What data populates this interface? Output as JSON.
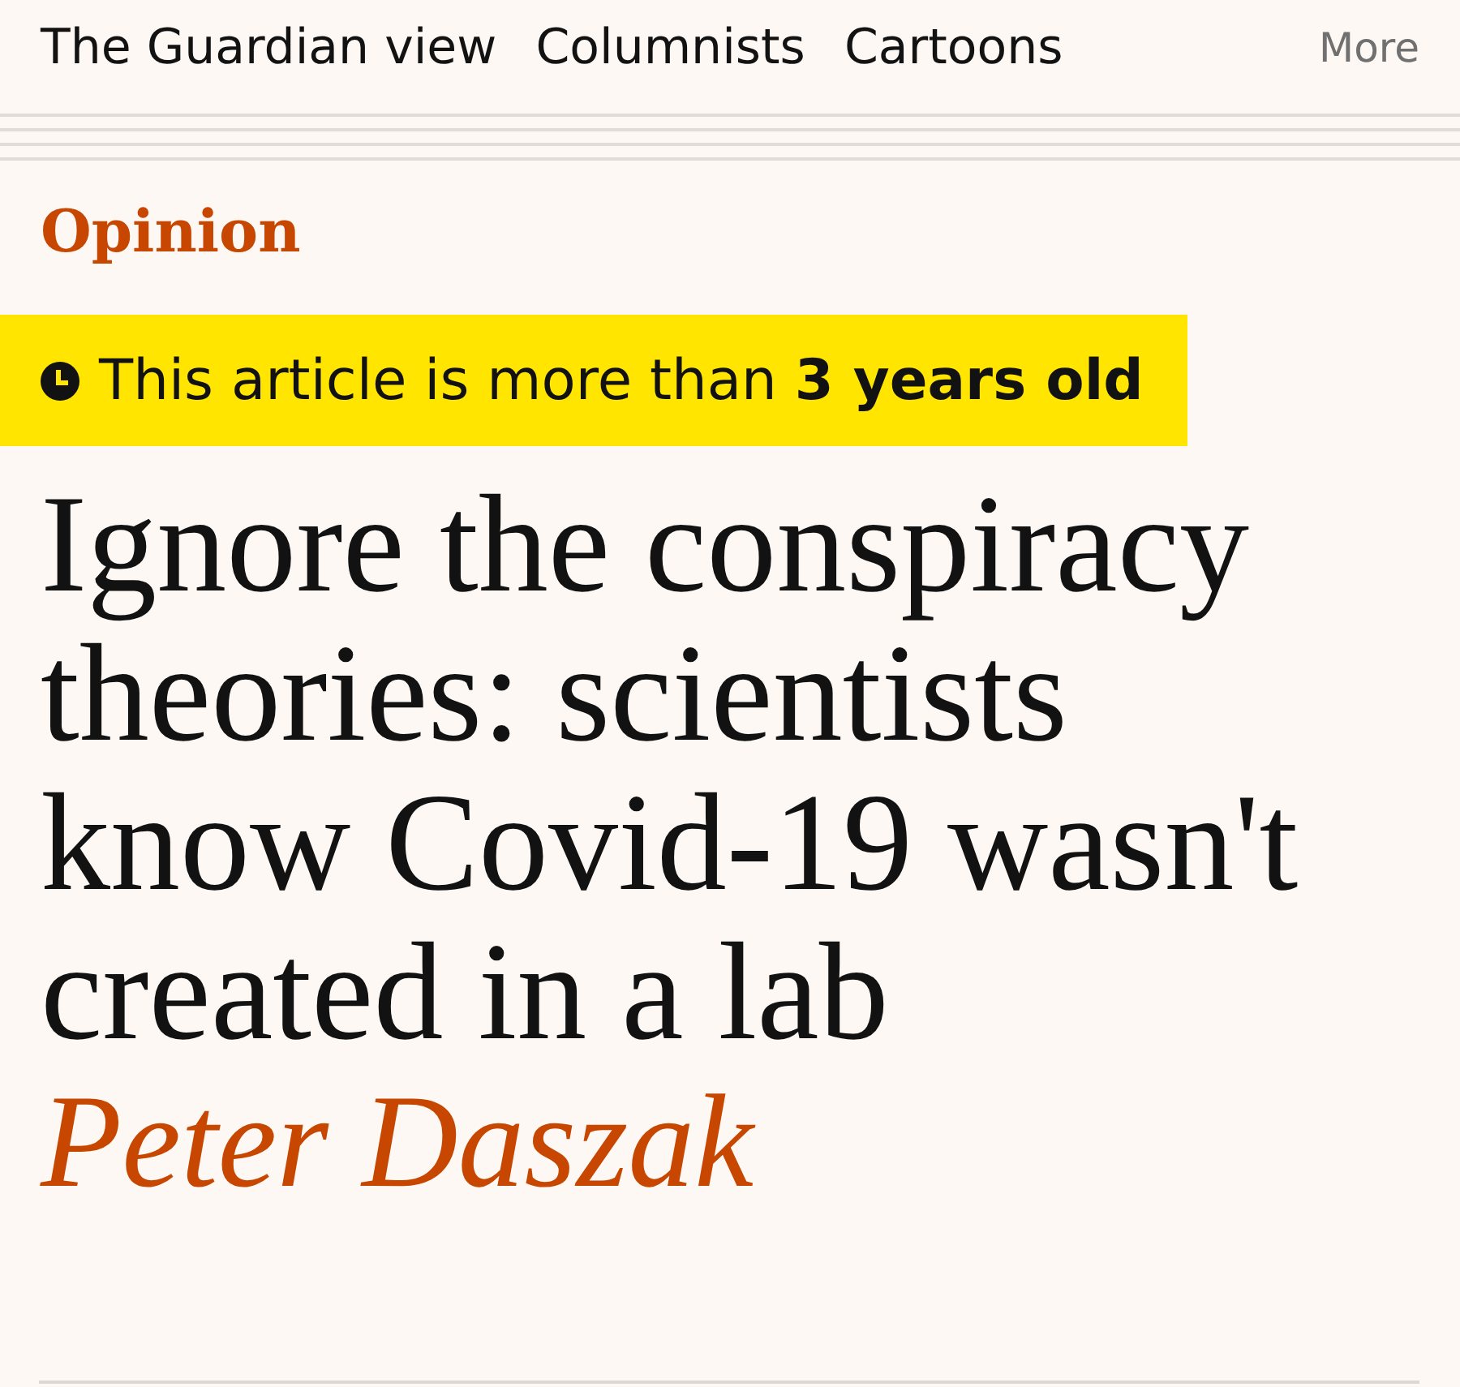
{
  "nav": {
    "items": [
      {
        "label": "The Guardian view"
      },
      {
        "label": "Columnists"
      },
      {
        "label": "Cartoons"
      }
    ],
    "more": "More"
  },
  "section": "Opinion",
  "age_notice": {
    "text": "This article is more than **3 years old**"
  },
  "headline": "Ignore the conspiracy theories: scientists know Covid-19 wasn't created in a lab",
  "byline": "Peter Daszak"
}
